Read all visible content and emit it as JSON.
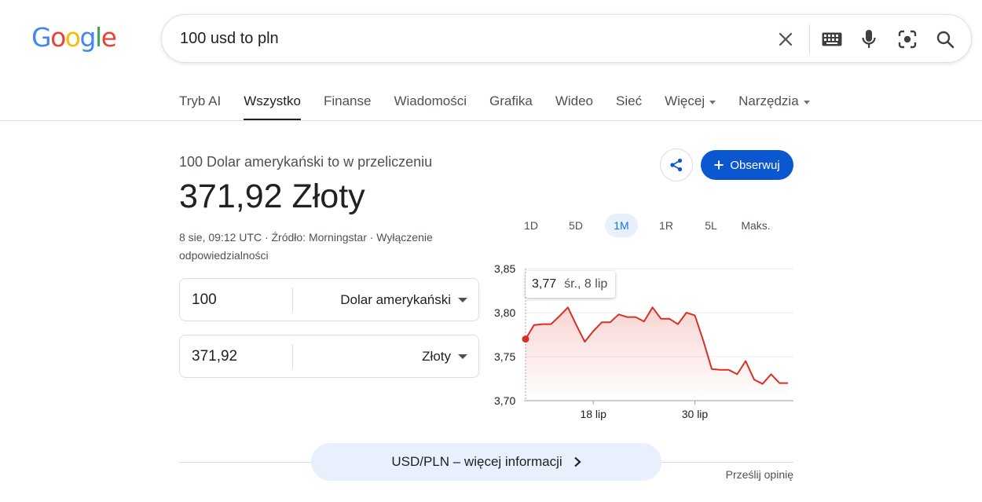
{
  "logo": {
    "letters": [
      "G",
      "o",
      "o",
      "g",
      "l",
      "e"
    ],
    "colors": [
      "#4285F4",
      "#EA4335",
      "#FBBC05",
      "#4285F4",
      "#34A853",
      "#EA4335"
    ]
  },
  "search": {
    "value": "100 usd to pln",
    "icons": [
      "close-icon",
      "keyboard-icon",
      "microphone-icon",
      "lens-icon",
      "search-icon"
    ]
  },
  "tabs": [
    {
      "label": "Tryb AI",
      "active": false,
      "dropdown": false
    },
    {
      "label": "Wszystko",
      "active": true,
      "dropdown": false
    },
    {
      "label": "Finanse",
      "active": false,
      "dropdown": false
    },
    {
      "label": "Wiadomości",
      "active": false,
      "dropdown": false
    },
    {
      "label": "Grafika",
      "active": false,
      "dropdown": false
    },
    {
      "label": "Wideo",
      "active": false,
      "dropdown": false
    },
    {
      "label": "Sieć",
      "active": false,
      "dropdown": false
    },
    {
      "label": "Więcej",
      "active": false,
      "dropdown": true
    },
    {
      "label": "Narzędzia",
      "active": false,
      "dropdown": true
    }
  ],
  "converter": {
    "subtitle": "100 Dolar amerykański to w przeliczeniu",
    "result": "371,92 Złoty",
    "meta": "8 sie, 09:12 UTC · Źródło: Morningstar · Wyłączenie odpowiedzialności",
    "from": {
      "amount": "100",
      "currency": "Dolar amerykański"
    },
    "to": {
      "amount": "371,92",
      "currency": "Złoty"
    }
  },
  "actions": {
    "follow_label": "Obserwuj",
    "share_icon": "share-icon",
    "accent": "#0b57d0"
  },
  "ranges": [
    {
      "label": "1D",
      "active": false
    },
    {
      "label": "5D",
      "active": false
    },
    {
      "label": "1M",
      "active": true
    },
    {
      "label": "1R",
      "active": false
    },
    {
      "label": "5L",
      "active": false
    },
    {
      "label": "Maks.",
      "active": false
    }
  ],
  "tooltip": {
    "value": "3,77",
    "date": "śr., 8 lip"
  },
  "chart_data": {
    "type": "area",
    "color": "#d93025",
    "y_ticks": [
      "3,85",
      "3,80",
      "3,75",
      "3,70"
    ],
    "ylim": [
      3.7,
      3.85
    ],
    "x_ticks": [
      "18 lip",
      "30 lip"
    ],
    "x_tick_index": [
      8,
      20
    ],
    "values": [
      3.77,
      3.786,
      3.787,
      3.787,
      3.796,
      3.806,
      3.786,
      3.767,
      3.779,
      3.789,
      3.789,
      3.798,
      3.795,
      3.795,
      3.79,
      3.806,
      3.793,
      3.793,
      3.787,
      3.8,
      3.797,
      3.768,
      3.736,
      3.735,
      3.735,
      3.73,
      3.745,
      3.724,
      3.719,
      3.73,
      3.72,
      3.72
    ],
    "highlight_index": 0,
    "grid": true
  },
  "bottom": {
    "more_info_label": "USD/PLN – więcej informacji",
    "feedback_label": "Prześlij opinię"
  }
}
